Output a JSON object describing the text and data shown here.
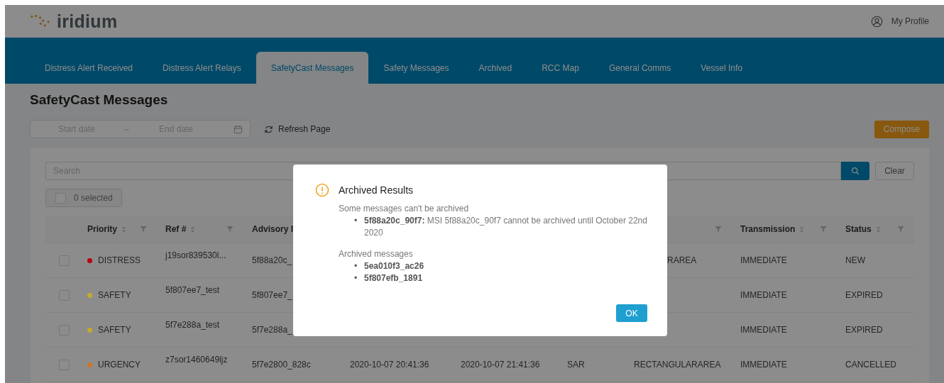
{
  "header": {
    "logo_text": "iridium",
    "profile_label": "My Profile"
  },
  "tabs": [
    {
      "label": "Distress Alert Received",
      "selected": false
    },
    {
      "label": "Distress Alert Relays",
      "selected": false
    },
    {
      "label": "SafetyCast Messages",
      "selected": true
    },
    {
      "label": "Safety Messages",
      "selected": false
    },
    {
      "label": "Archived",
      "selected": false
    },
    {
      "label": "RCC Map",
      "selected": false
    },
    {
      "label": "General Comms",
      "selected": false
    },
    {
      "label": "Vessel Info",
      "selected": false
    }
  ],
  "page_title": "SafetyCast Messages",
  "date_range": {
    "start_placeholder": "Start date",
    "separator": "~",
    "end_placeholder": "End date"
  },
  "refresh_label": "Refresh Page",
  "compose_label": "Compose",
  "search": {
    "placeholder": "Search",
    "clear_label": "Clear"
  },
  "selection": {
    "label": "0 selected",
    "checked": false
  },
  "columns": [
    {
      "label": "Priority",
      "sorter": true,
      "filter": true
    },
    {
      "label": "Ref #",
      "sorter": true,
      "filter": true
    },
    {
      "label": "Advisory I"
    },
    {},
    {},
    {},
    {
      "sorter": false,
      "filter": true
    },
    {
      "label": "Transmission",
      "sorter": true,
      "filter": true
    },
    {
      "label": "Status",
      "sorter": true,
      "filter": true
    }
  ],
  "rows": [
    {
      "checked": false,
      "priority": "DISTRESS",
      "color": "#b80012",
      "ref": "j19sor839530l...",
      "advisory": "5f88a20c_",
      "area": "RAREA",
      "area_clipped": true,
      "transmission": "IMMEDIATE",
      "status": "NEW"
    },
    {
      "checked": false,
      "priority": "SAFETY",
      "color": "#c4ab2c",
      "ref": "5f807ee7_test",
      "advisory": "5f807ee7_",
      "transmission": "IMMEDIATE",
      "status": "EXPIRED"
    },
    {
      "checked": false,
      "priority": "SAFETY",
      "color": "#c4ab2c",
      "ref": "5f7e288a_test",
      "advisory": "5f7e288a_",
      "transmission": "IMMEDIATE",
      "status": "EXPIRED"
    },
    {
      "checked": false,
      "priority": "URGENCY",
      "color": "#c8792a",
      "ref": "z7sor1460649ljz",
      "advisory": "5f7e2800_828c",
      "sent": "2020-10-07 20:41:36",
      "expires": "2020-10-07 21:41:36",
      "type": "SAR",
      "area": "RECTANGULARAREA",
      "area_clipped": false,
      "transmission": "IMMEDIATE",
      "status": "CANCELLED"
    }
  ],
  "dialog": {
    "title": "Archived Results",
    "failed_heading": "Some messages can't be archived",
    "failed": [
      {
        "id": "5f88a20c_90f7:",
        "reason": "MSI 5f88a20c_90f7 cannot be archived until October 22nd 2020"
      }
    ],
    "bullet": "•",
    "archived_heading": "Archived messages",
    "archived": [
      "5ea010f3_ac26",
      "5f807efb_1891"
    ],
    "ok_label": "OK"
  }
}
